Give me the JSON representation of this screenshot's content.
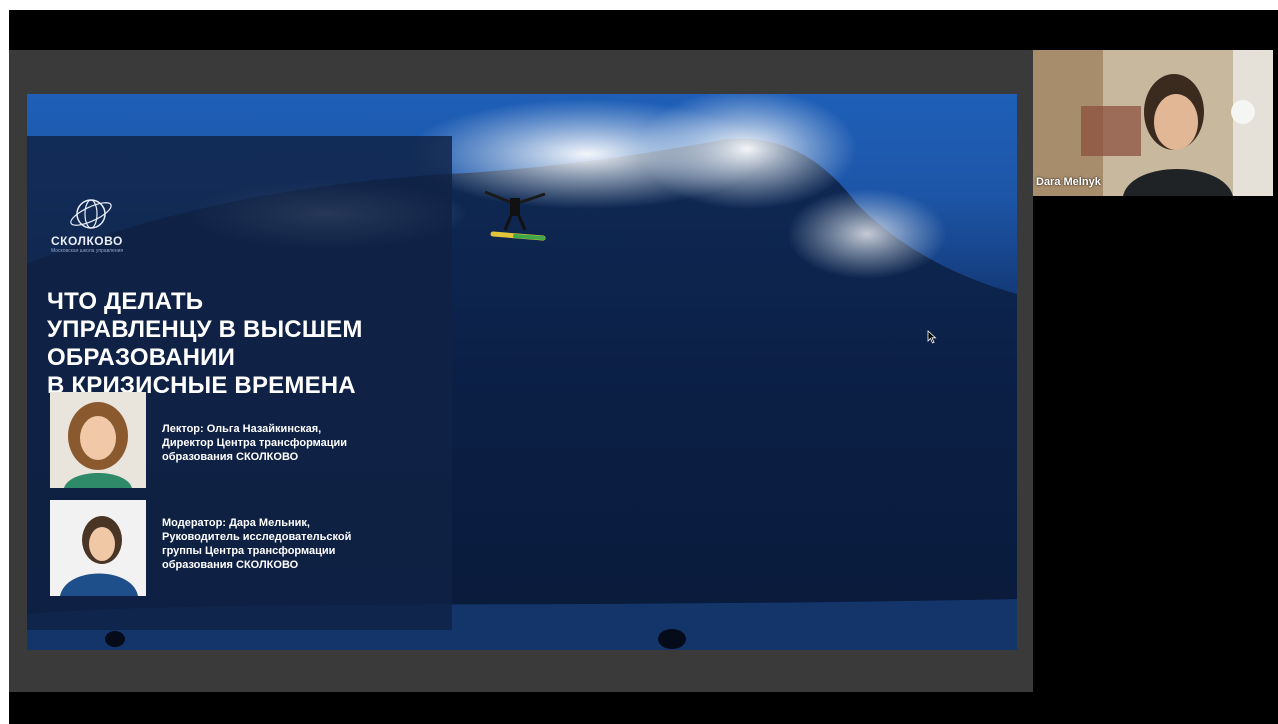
{
  "slide": {
    "logo_text": "СКОЛКОВО",
    "logo_subtitle": "Московская школа управления",
    "title_lines": [
      "ЧТО ДЕЛАТЬ",
      "УПРАВЛЕНЦУ В ВЫСШЕМ",
      "ОБРАЗОВАНИИ",
      "В КРИЗИСНЫЕ ВРЕМЕНА"
    ],
    "lecturer_lines": [
      "Лектор: Ольга Назайкинская,",
      "Директор Центра трансформации",
      "образования СКОЛКОВО"
    ],
    "moderator_lines": [
      "Модератор: Дара Мельник,",
      "Руководитель исследовательской",
      "группы Центра трансформации",
      "образования СКОЛКОВО"
    ]
  },
  "video": {
    "participant_name": "Dara Melnyk"
  },
  "colors": {
    "panel": "#102244",
    "ocean": "#0a1d45",
    "sky": "#1f5fb8"
  },
  "icons": [
    "skolkovo-logo-icon",
    "mouse-cursor-icon"
  ]
}
